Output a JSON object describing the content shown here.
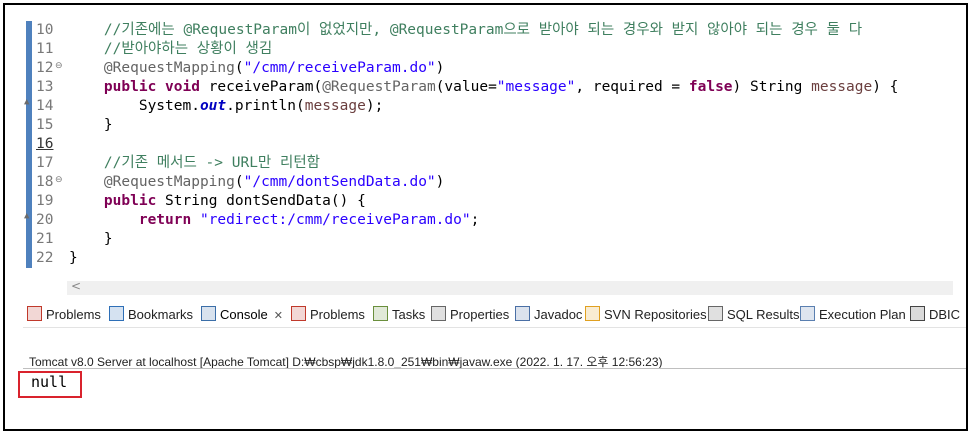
{
  "editor": {
    "lines": [
      {
        "num": "10",
        "parts": [
          [
            "",
            "    "
          ],
          [
            "cm",
            "//기존에는 @RequestParam이 없었지만, @RequestParam으로 받아야 되는 경우와 받지 않아야 되는 경우 둘 다"
          ]
        ]
      },
      {
        "num": "11",
        "parts": [
          [
            "",
            "    "
          ],
          [
            "cm",
            "//받아야하는 상황이 생김"
          ]
        ]
      },
      {
        "num": "12",
        "fold": true,
        "parts": [
          [
            "",
            "    "
          ],
          [
            "ann",
            "@RequestMapping"
          ],
          [
            "",
            "("
          ],
          [
            "str",
            "\"/cmm/receiveParam.do\""
          ],
          [
            "",
            ")"
          ]
        ]
      },
      {
        "num": "13",
        "parts": [
          [
            "",
            "    "
          ],
          [
            "kw",
            "public"
          ],
          [
            "",
            " "
          ],
          [
            "kw",
            "void"
          ],
          [
            "",
            " receiveParam("
          ],
          [
            "ann",
            "@RequestParam"
          ],
          [
            "",
            "(value="
          ],
          [
            "str",
            "\"message\""
          ],
          [
            "",
            ", required = "
          ],
          [
            "kw",
            "false"
          ],
          [
            "",
            ") String "
          ],
          [
            "par",
            "message"
          ],
          [
            "",
            ") {"
          ]
        ]
      },
      {
        "num": "14",
        "override": true,
        "parts": [
          [
            "",
            "        System."
          ],
          [
            "fld",
            "out"
          ],
          [
            "",
            ".println("
          ],
          [
            "par",
            "message"
          ],
          [
            "",
            ");"
          ]
        ]
      },
      {
        "num": "15",
        "parts": [
          [
            "",
            "    }"
          ]
        ]
      },
      {
        "num": "16",
        "current": true,
        "parts": [
          [
            "",
            ""
          ]
        ]
      },
      {
        "num": "17",
        "parts": [
          [
            "",
            "    "
          ],
          [
            "cm",
            "//기존 메서드 -> URL만 리턴함"
          ]
        ]
      },
      {
        "num": "18",
        "fold": true,
        "parts": [
          [
            "",
            "    "
          ],
          [
            "ann",
            "@RequestMapping"
          ],
          [
            "",
            "("
          ],
          [
            "str",
            "\"/cmm/dontSendData.do\""
          ],
          [
            "",
            ")"
          ]
        ]
      },
      {
        "num": "19",
        "parts": [
          [
            "",
            "    "
          ],
          [
            "kw",
            "public"
          ],
          [
            "",
            " String dontSendData() {"
          ]
        ]
      },
      {
        "num": "20",
        "override": true,
        "parts": [
          [
            "",
            "        "
          ],
          [
            "kw",
            "return"
          ],
          [
            "",
            " "
          ],
          [
            "str",
            "\"redirect:/cmm/receiveParam.do\""
          ],
          [
            "",
            ";"
          ]
        ]
      },
      {
        "num": "21",
        "parts": [
          [
            "",
            "    }"
          ]
        ]
      },
      {
        "num": "22",
        "parts": [
          [
            "",
            "}"
          ]
        ]
      }
    ],
    "scroll_left_glyph": "<"
  },
  "tabs": [
    {
      "label": "Problems",
      "icon": "problems-icon",
      "color": "#c0392b"
    },
    {
      "label": "Bookmarks",
      "icon": "bookmarks-icon",
      "color": "#2e6fb7"
    },
    {
      "label": "Console",
      "icon": "console-icon",
      "color": "#3b6ea8",
      "active": true,
      "close": "✕"
    },
    {
      "label": "Problems",
      "icon": "problems-icon",
      "color": "#c0392b"
    },
    {
      "label": "Tasks",
      "icon": "tasks-icon",
      "color": "#6a8f3c"
    },
    {
      "label": "Properties",
      "icon": "properties-icon",
      "color": "#666666"
    },
    {
      "label": "Javadoc",
      "icon": "javadoc-icon",
      "color": "#4a6fa5"
    },
    {
      "label": "SVN Repositories",
      "icon": "svn-icon",
      "color": "#e0a020"
    },
    {
      "label": "SQL Results",
      "icon": "sql-results-icon",
      "color": "#666666"
    },
    {
      "label": "Execution Plan",
      "icon": "execution-plan-icon",
      "color": "#5a7fb0"
    },
    {
      "label": "DBIC",
      "icon": "dbic-search-icon",
      "color": "#444444"
    }
  ],
  "console": {
    "title": "Tomcat v8.0 Server at localhost [Apache Tomcat] D:₩cbsp₩jdk1.8.0_251₩bin₩javaw.exe (2022. 1. 17. 오후 12:56:23)",
    "output": "null"
  },
  "colors": {
    "highlight": "#d9232d",
    "marker": "#4f81bd"
  }
}
